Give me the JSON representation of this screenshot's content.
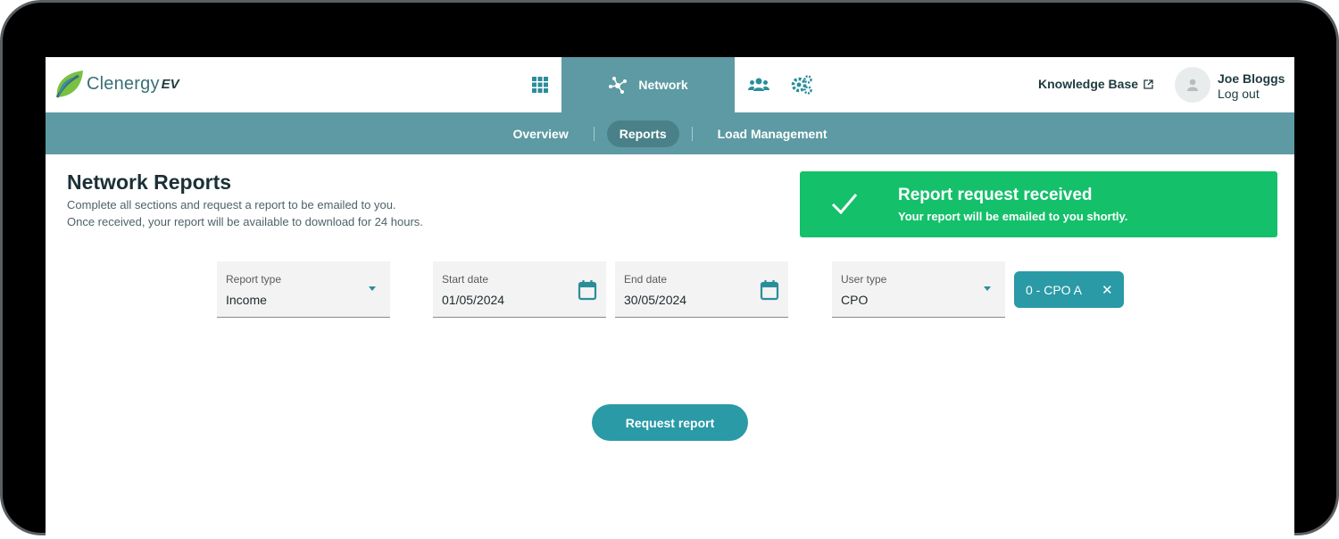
{
  "brand": {
    "name": "Clenergy",
    "suffix": "EV"
  },
  "nav": {
    "network_label": "Network",
    "knowledge_base": "Knowledge Base",
    "user_name": "Joe Bloggs",
    "logout": "Log out"
  },
  "subnav": {
    "tabs": [
      {
        "label": "Overview",
        "active": false
      },
      {
        "label": "Reports",
        "active": true
      },
      {
        "label": "Load Management",
        "active": false
      }
    ]
  },
  "page": {
    "title": "Network Reports",
    "desc1": "Complete all sections and request a report to be emailed to you.",
    "desc2": "Once received, your report will be available to download for 24 hours."
  },
  "toast": {
    "title": "Report request received",
    "subtitle": "Your report will be emailed to you shortly."
  },
  "form": {
    "report_type": {
      "label": "Report type",
      "value": "Income"
    },
    "start_date": {
      "label": "Start date",
      "value": "01/05/2024"
    },
    "end_date": {
      "label": "End date",
      "value": "30/05/2024"
    },
    "user_type": {
      "label": "User type",
      "value": "CPO"
    },
    "chip": {
      "label": "0 - CPO A",
      "remove": "✕"
    },
    "submit_label": "Request report"
  },
  "colors": {
    "teal": "#5d9aa3",
    "accent": "#2a9aa6",
    "success": "#14c06a"
  }
}
